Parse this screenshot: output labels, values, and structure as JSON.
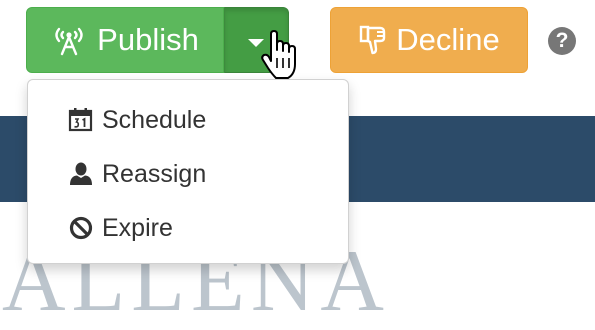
{
  "toolbar": {
    "publish": {
      "label": "Publish",
      "icon": "antenna-icon"
    },
    "publish_dropdown_toggle": {
      "icon": "caret-down-icon"
    },
    "decline": {
      "label": "Decline",
      "icon": "thumbs-down-icon"
    },
    "help": {
      "glyph": "?",
      "icon": "question-circle-icon"
    }
  },
  "publish_menu": {
    "items": [
      {
        "label": "Schedule",
        "icon": "calendar-icon"
      },
      {
        "label": "Reassign",
        "icon": "user-icon"
      },
      {
        "label": "Expire",
        "icon": "ban-icon"
      }
    ]
  },
  "background": {
    "brand_text": "ALLENA"
  },
  "colors": {
    "publish_green": "#5cb85c",
    "publish_green_active": "#449d44",
    "decline_orange": "#f0ad4e",
    "banner_navy": "#2c4b69",
    "help_gray": "#777777"
  }
}
